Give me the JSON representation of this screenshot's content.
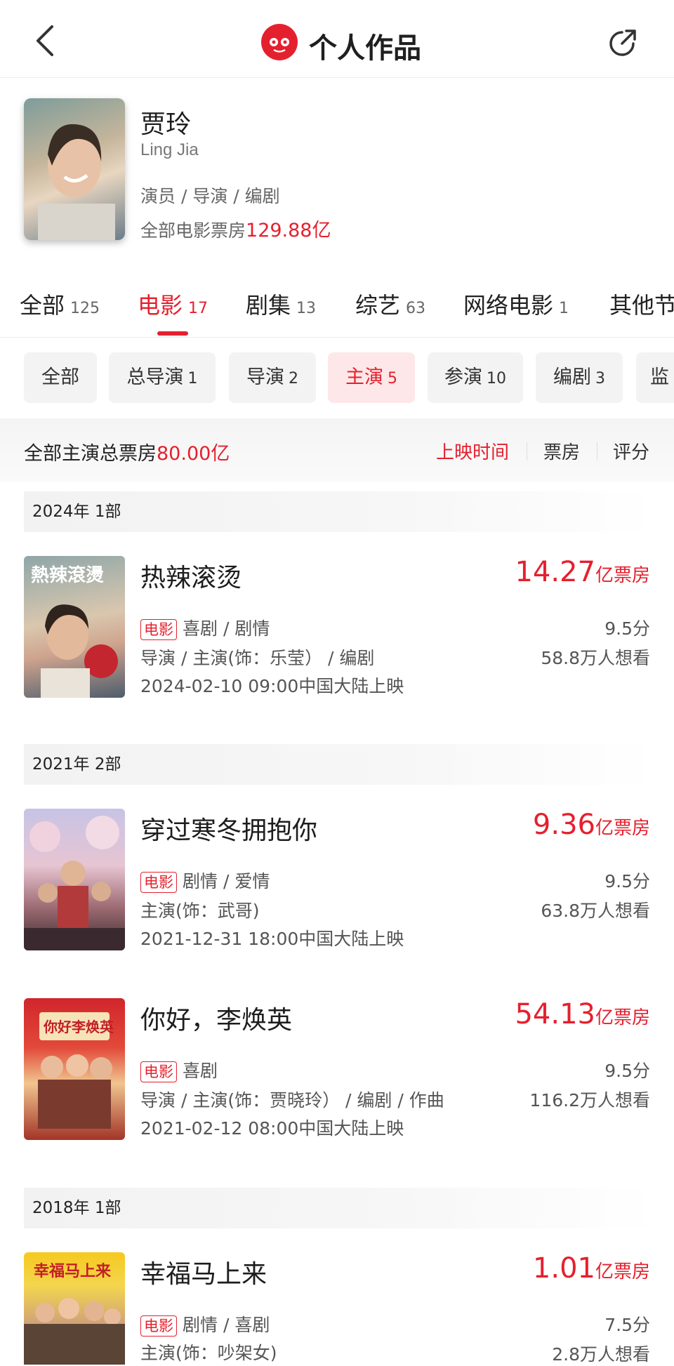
{
  "header": {
    "title": "个人作品"
  },
  "profile": {
    "name": "贾玲",
    "name_en": "Ling Jia",
    "roles": "演员 / 导演 / 编剧",
    "total_label": "全部电影票房",
    "total_value": "129.88亿"
  },
  "tabs": [
    {
      "label": "全部",
      "count": "125"
    },
    {
      "label": "电影",
      "count": "17"
    },
    {
      "label": "剧集",
      "count": "13"
    },
    {
      "label": "综艺",
      "count": "63"
    },
    {
      "label": "网络电影",
      "count": "1"
    },
    {
      "label": "其他节"
    }
  ],
  "chips": [
    {
      "label": "全部"
    },
    {
      "label": "总导演",
      "count": "1"
    },
    {
      "label": "导演",
      "count": "2"
    },
    {
      "label": "主演",
      "count": "5"
    },
    {
      "label": "参演",
      "count": "10"
    },
    {
      "label": "编剧",
      "count": "3"
    },
    {
      "label": "监"
    }
  ],
  "summary": {
    "label": "全部主演总票房",
    "value": "80.00亿",
    "sort_options": [
      "上映时间",
      "票房",
      "评分"
    ]
  },
  "years": [
    "2024年   1部",
    "2021年   2部",
    "2018年   1部"
  ],
  "movies": [
    {
      "title": "热辣滚烫",
      "box_value": "14.27",
      "box_unit": "亿票房",
      "tag": "电影",
      "genre": "喜剧 / 剧情",
      "role": "导演 / 主演(饰：乐莹） / 编剧",
      "date": "2024-02-10 09:00中国大陆上映",
      "score": "9.5分",
      "want": "58.8万人想看"
    },
    {
      "title": "穿过寒冬拥抱你",
      "box_value": "9.36",
      "box_unit": "亿票房",
      "tag": "电影",
      "genre": "剧情 / 爱情",
      "role": "主演(饰：武哥)",
      "date": "2021-12-31 18:00中国大陆上映",
      "score": "9.5分",
      "want": "63.8万人想看"
    },
    {
      "title": "你好，李焕英",
      "box_value": "54.13",
      "box_unit": "亿票房",
      "tag": "电影",
      "genre": "喜剧",
      "role": "导演 / 主演(饰：贾晓玲） / 编剧 / 作曲",
      "date": "2021-02-12 08:00中国大陆上映",
      "score": "9.5分",
      "want": "116.2万人想看"
    },
    {
      "title": "幸福马上来",
      "box_value": "1.01",
      "box_unit": "亿票房",
      "tag": "电影",
      "genre": "剧情 / 喜剧",
      "role": "主演(饰：吵架女)",
      "date": "",
      "score": "7.5分",
      "want": "2.8万人想看"
    }
  ]
}
